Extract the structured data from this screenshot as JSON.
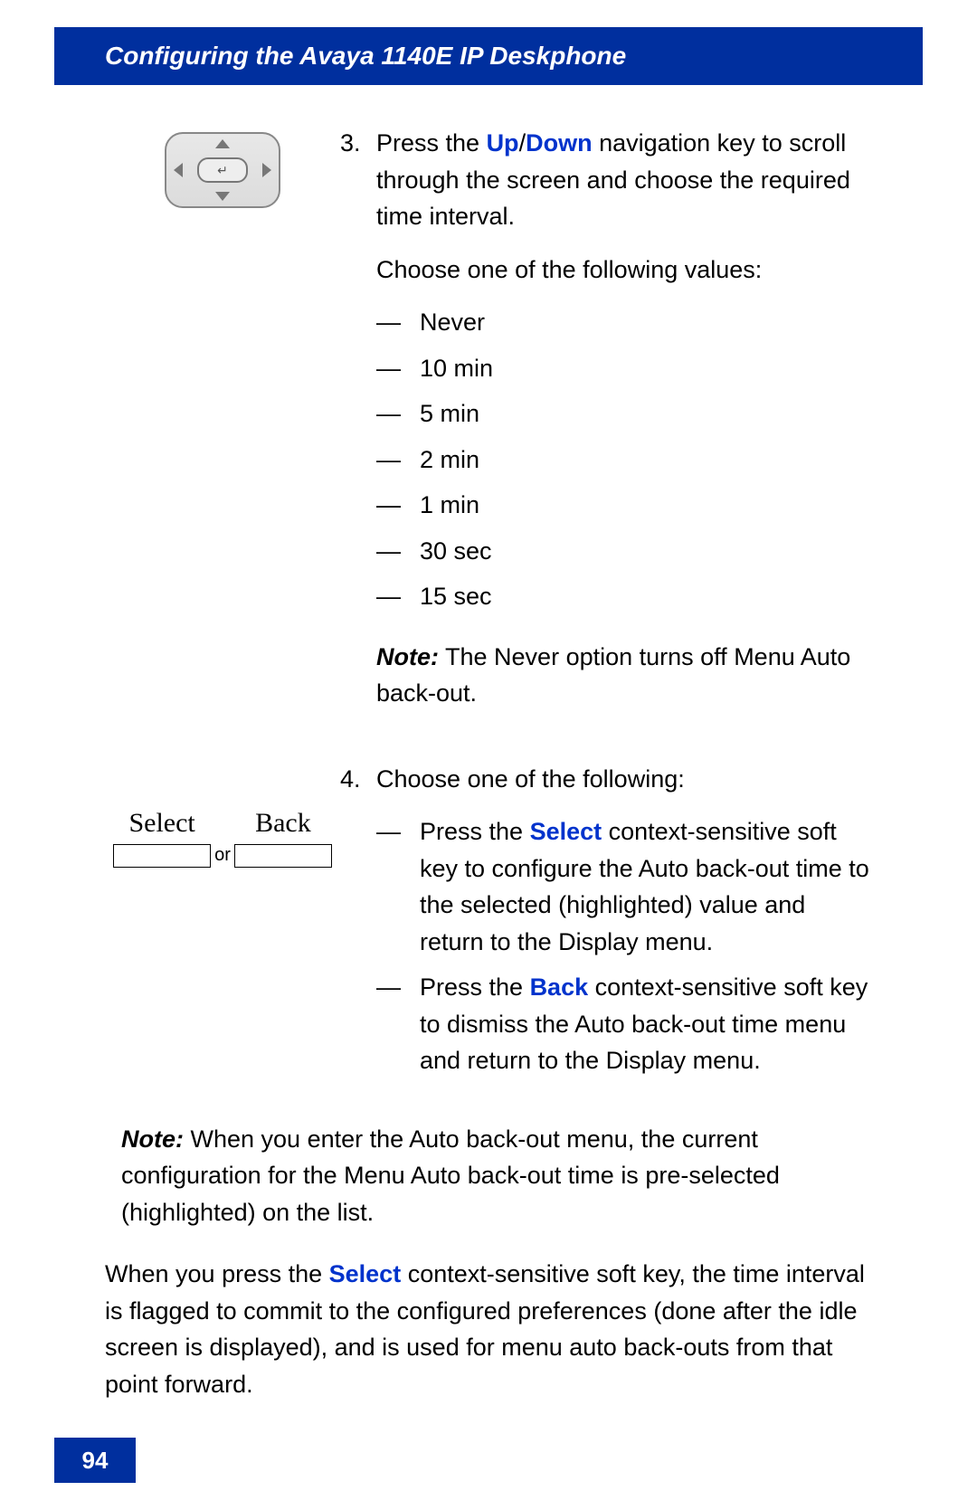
{
  "header": {
    "title": "Configuring the Avaya 1140E IP Deskphone"
  },
  "step3": {
    "num": "3.",
    "text_before_kw1": "Press the ",
    "kw1": "Up",
    "slash": "/",
    "kw2": "Down",
    "text_after_kw": " navigation key to scroll through the screen and choose the required time interval.",
    "choose_line": "Choose one of the following values:",
    "options": [
      "Never",
      "10 min",
      "5 min",
      "2 min",
      "1 min",
      "30 sec",
      "15 sec"
    ],
    "note_label": "Note:",
    "note_text": "  The Never option turns off Menu Auto back-out."
  },
  "step4": {
    "num": "4.",
    "intro": "Choose one of the following:",
    "softkey_labels": {
      "select": "Select",
      "back": "Back",
      "or": "or"
    },
    "item1_pre": "Press the ",
    "item1_kw": "Select",
    "item1_post": " context-sensitive soft key to configure the Auto back-out time to the selected (highlighted) value and return to the Display menu.",
    "item2_pre": "Press the ",
    "item2_kw": "Back",
    "item2_post": " context-sensitive soft key to dismiss the Auto back-out time menu and return to the Display menu."
  },
  "bottom_note": {
    "label": "Note:",
    "text": "  When you enter the Auto back-out menu, the current configuration for the Menu Auto back-out time is pre-selected (highlighted) on the list."
  },
  "final_para": {
    "pre": "When you press the ",
    "kw": "Select",
    "post": " context-sensitive soft key, the time interval is flagged to commit to the configured preferences (done after the idle screen is displayed), and is used for menu auto back-outs from that point forward."
  },
  "page_number": "94"
}
